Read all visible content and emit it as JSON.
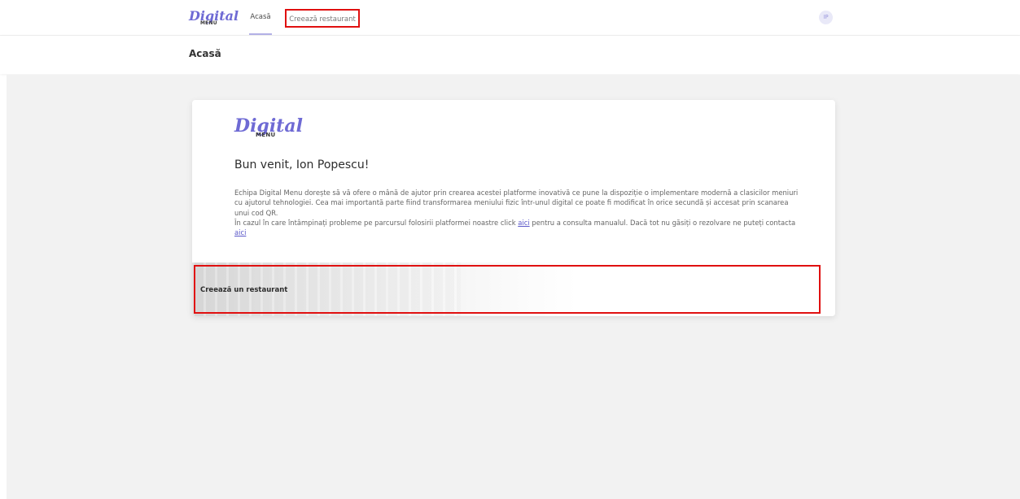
{
  "nav": {
    "logo_main": "Digital",
    "logo_sub": "MENU",
    "home_label": "Acasă",
    "create_label": "Creează restaurant",
    "user_initials": "IP"
  },
  "header": {
    "title": "Acasă"
  },
  "card": {
    "logo_main": "Digital",
    "logo_sub": "MENU",
    "welcome": "Bun venit, Ion Popescu!",
    "intro_p1": "Echipa Digital Menu dorește să vă ofere o mână de ajutor prin crearea acestei platforme inovativă ce pune la dispoziție o implementare modernă a clasicilor meniuri cu ajutorul tehnologiei. Cea mai importantă parte fiind transformarea meniului fizic într-unul digital ce poate fi modificat în orice secundă și accesat prin scanarea unui cod QR.",
    "intro_p2_before": "În cazul în care întâmpinați probleme pe parcursul folosirii platformei noastre click ",
    "manual_link": "aici",
    "intro_p2_middle": " pentru a consulta manualul. Dacă tot nu găsiți o rezolvare ne puteți contacta ",
    "contact_link": "aici",
    "create_banner_label": "Creează un restaurant"
  },
  "colors": {
    "brand": "#6e6ad4",
    "highlight": "#e01010"
  }
}
